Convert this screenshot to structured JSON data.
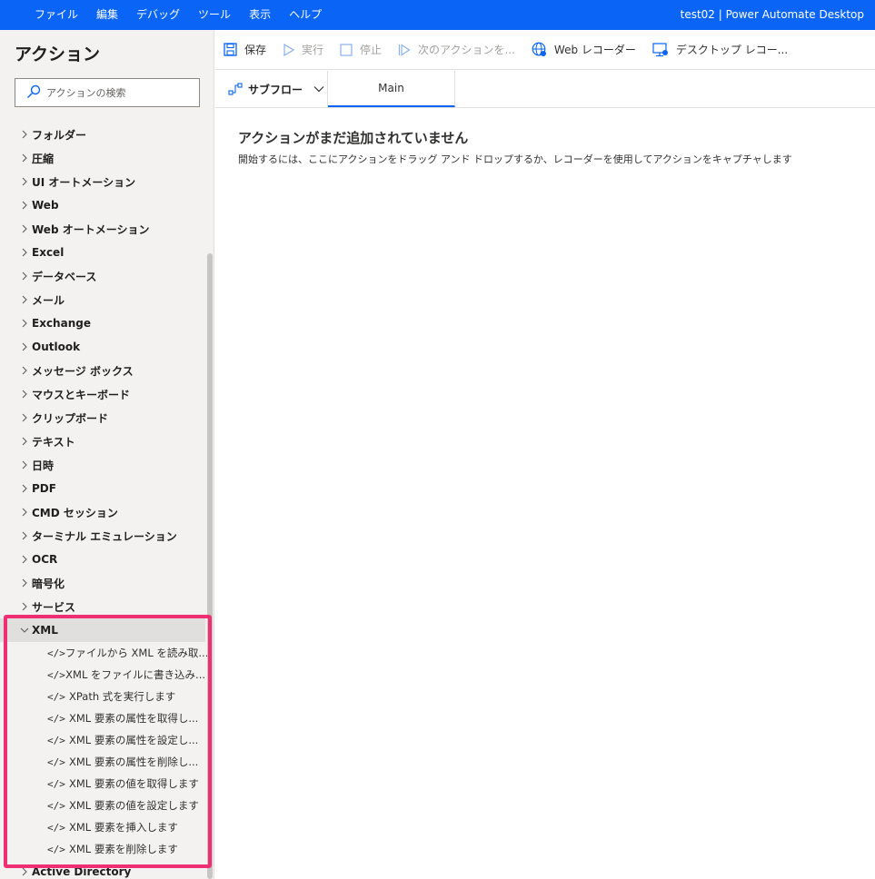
{
  "menubar": {
    "items": [
      "ファイル",
      "編集",
      "デバッグ",
      "ツール",
      "表示",
      "ヘルプ"
    ],
    "app_title": "test02 | Power Automate Desktop"
  },
  "actions_panel": {
    "title": "アクション",
    "search_placeholder": "アクションの検索",
    "categories": [
      "フォルダー",
      "圧縮",
      "UI オートメーション",
      "Web",
      "Web オートメーション",
      "Excel",
      "データベース",
      "メール",
      "Exchange",
      "Outlook",
      "メッセージ ボックス",
      "マウスとキーボード",
      "クリップボード",
      "テキスト",
      "日時",
      "PDF",
      "CMD セッション",
      "ターミナル エミュレーション",
      "OCR",
      "暗号化",
      "サービス"
    ],
    "expanded_category": {
      "label": "XML",
      "items": [
        "ファイルから XML を読み取...",
        "XML をファイルに書き込み...",
        "XPath 式を実行します",
        "XML 要素の属性を取得し...",
        "XML 要素の属性を設定し...",
        "XML 要素の属性を削除し...",
        "XML 要素の値を取得します",
        "XML 要素の値を設定します",
        "XML 要素を挿入します",
        "XML 要素を削除します"
      ]
    },
    "next_category": "Active Directory",
    "action_icon_text": "</>"
  },
  "toolbar": {
    "save": "保存",
    "run": "実行",
    "stop": "停止",
    "next_action": "次のアクションを...",
    "web_recorder": "Web レコーダー",
    "desktop_recorder": "デスクトップ レコー..."
  },
  "tabs": {
    "subflow": "サブフロー",
    "main": "Main"
  },
  "canvas": {
    "empty_title": "アクションがまだ追加されていません",
    "empty_description": "開始するには、ここにアクションをドラッグ アンド ドロップするか、レコーダーを使用してアクションをキャプチャします"
  },
  "colors": {
    "accent": "#0a64f5",
    "highlight": "#ef2f73"
  }
}
